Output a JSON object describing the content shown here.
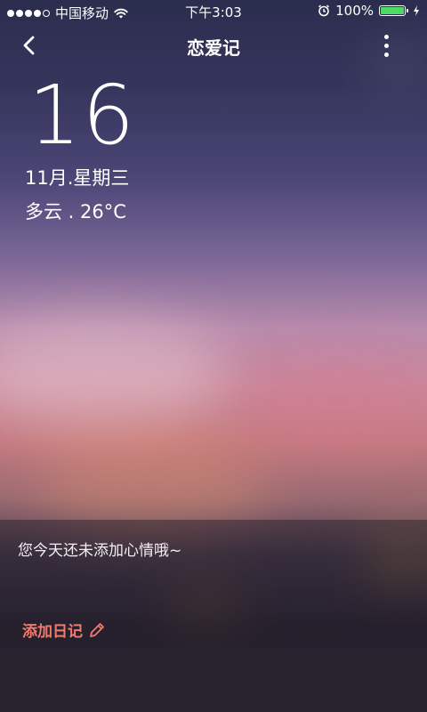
{
  "status_bar": {
    "carrier": "中国移动",
    "time": "下午3:03",
    "battery_percent": "100%",
    "signal_bars_filled": 4,
    "signal_bars_total": 5,
    "battery_color": "#4cd964"
  },
  "nav": {
    "title": "恋爱记",
    "back_icon": "chevron-left-icon",
    "more_icon": "more-vertical-icon"
  },
  "date": {
    "day": "16",
    "month_weekday": "11月.星期三",
    "weather": "多云 . 26°C"
  },
  "mood": {
    "message": "您今天还未添加心情哦~",
    "add_diary_label": "添加日记",
    "add_diary_icon": "pencil-icon",
    "accent_color": "#f07b6e"
  }
}
